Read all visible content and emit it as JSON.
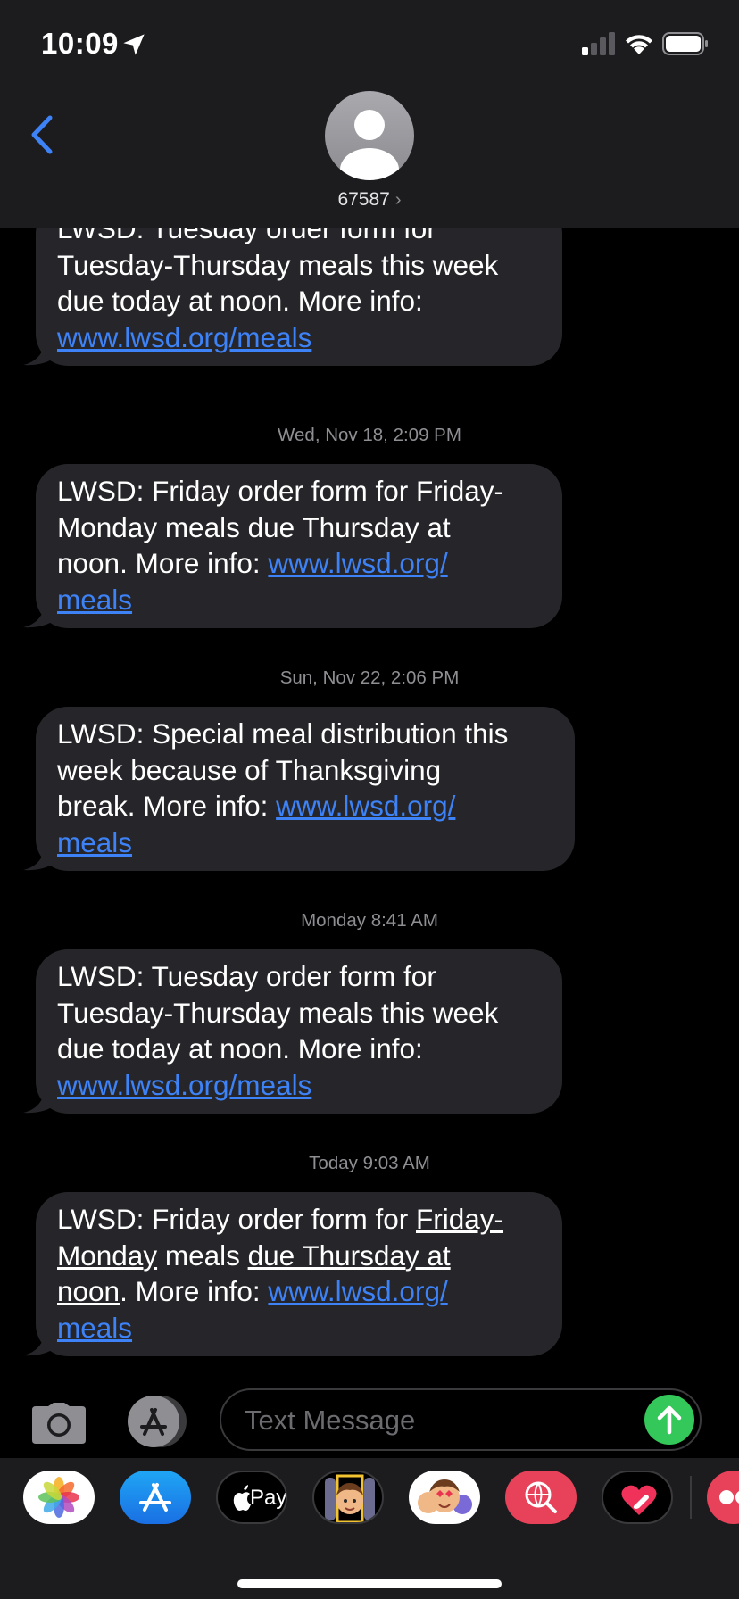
{
  "status_bar": {
    "time": "10:09"
  },
  "header": {
    "contact": "67587",
    "chevron": "›"
  },
  "timestamps": [
    {
      "day": "Wed, Nov 18,",
      "time": "2:09 PM"
    },
    {
      "day": "Sun, Nov 22,",
      "time": "2:06 PM"
    },
    {
      "day": "Monday",
      "time": "8:41 AM"
    },
    {
      "day": "Today",
      "time": "9:03 AM"
    }
  ],
  "messages": [
    {
      "line1": "LWSD: Tuesday order form for",
      "line2": "Tuesday-Thursday meals this week",
      "line3": "due today at noon. More info:",
      "link": "www.lwsd.org/meals"
    },
    {
      "text_a": "LWSD: Friday order form for Friday-",
      "text_b": "Monday meals due Thursday at",
      "text_c": "noon. More info: ",
      "link_a": "www.lwsd.org/",
      "link_b": "meals"
    },
    {
      "text_a": "LWSD: Special meal distribution this",
      "text_b": "week because of Thanksgiving",
      "text_c": "break. More info: ",
      "link_a": "www.lwsd.org/",
      "link_b": "meals"
    },
    {
      "line1": "LWSD: Tuesday order form for",
      "line2": "Tuesday-Thursday meals this week",
      "line3": "due today at noon. More info:",
      "link": "www.lwsd.org/meals"
    },
    {
      "pre": "LWSD: Friday order form for ",
      "dd1": "Friday-",
      "dd2": "Monday",
      "mid": " meals ",
      "dd3": "due Thursday at",
      "dd4": "noon",
      "post": ". More info: ",
      "link_a": "www.lwsd.org/",
      "link_b": "meals"
    }
  ],
  "input": {
    "placeholder": "Text Message"
  },
  "drawer": {
    "apple_pay_label": "Pay"
  },
  "colors": {
    "link": "#3d82f6",
    "bubble": "#26262a",
    "send": "#34c759",
    "bar": "#1c1c1e"
  }
}
